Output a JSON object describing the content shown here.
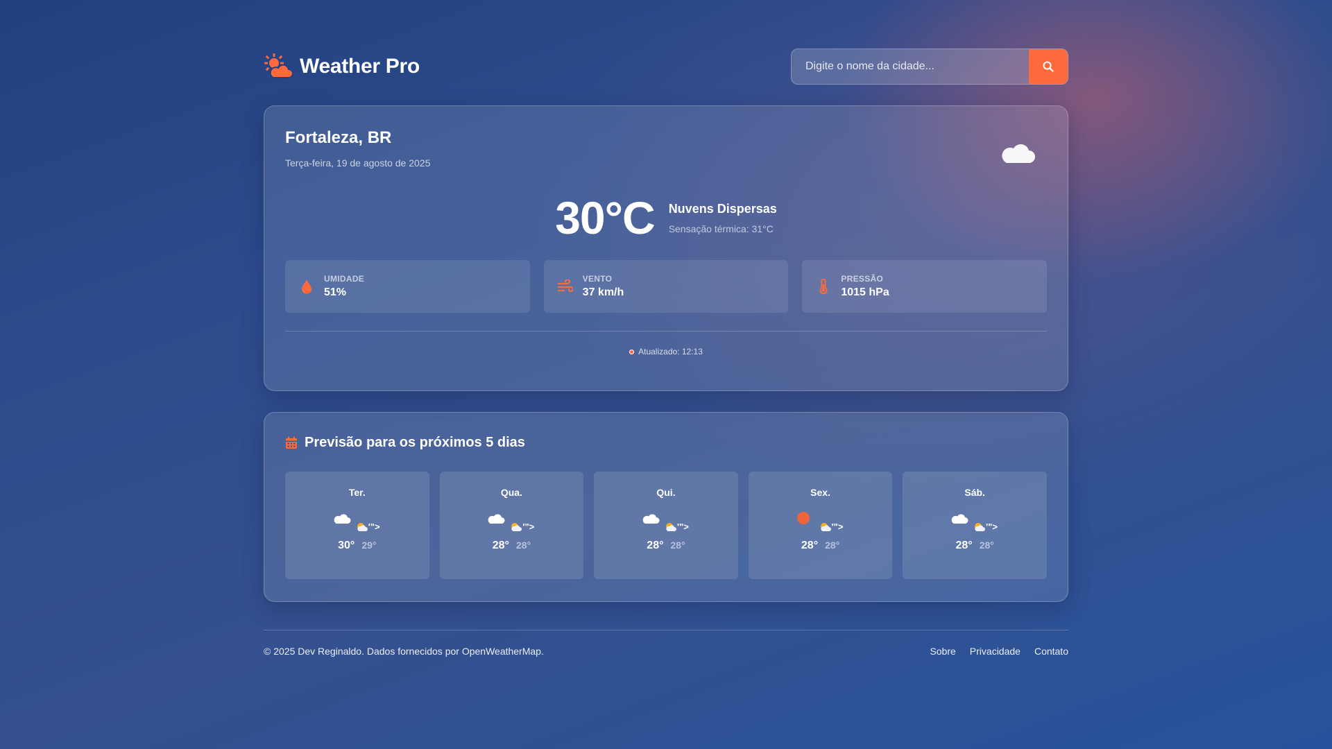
{
  "header": {
    "brand_title": "Weather Pro",
    "search_placeholder": "Digite o nome da cidade...",
    "search_value": ""
  },
  "current": {
    "city": "Fortaleza, BR",
    "date": "Terça-feira, 19 de agosto de 2025",
    "icon": "cloud-icon",
    "temperature": "30°C",
    "description": "Nuvens Dispersas",
    "feels_like": "Sensação térmica: 31°C",
    "stats": [
      {
        "label": "Umidade",
        "value": "51%",
        "icon": "droplet-icon"
      },
      {
        "label": "Vento",
        "value": "37 km/h",
        "icon": "wind-icon"
      },
      {
        "label": "Pressão",
        "value": "1015 hPa",
        "icon": "thermometer-icon"
      }
    ],
    "updated": "Atualizado: 12:13"
  },
  "forecast": {
    "title": "Previsão para os próximos 5 dias",
    "days": [
      {
        "name": "Ter.",
        "icon": "cloud-icon",
        "broken_text": "'\">",
        "max": "30°",
        "min": "29°"
      },
      {
        "name": "Qua.",
        "icon": "cloud-icon",
        "broken_text": "'\">",
        "max": "28°",
        "min": "28°"
      },
      {
        "name": "Qui.",
        "icon": "cloud-icon",
        "broken_text": "'\">",
        "max": "28°",
        "min": "28°"
      },
      {
        "name": "Sex.",
        "icon": "sun-dot-icon",
        "broken_text": "'\">",
        "max": "28°",
        "min": "28°"
      },
      {
        "name": "Sáb.",
        "icon": "cloud-icon",
        "broken_text": "'\">",
        "max": "28°",
        "min": "28°"
      }
    ]
  },
  "footer": {
    "copyright": "© 2025 Dev Reginaldo. Dados fornecidos por OpenWeatherMap.",
    "links": [
      "Sobre",
      "Privacidade",
      "Contato"
    ]
  },
  "colors": {
    "accent": "#ff6a3d"
  }
}
